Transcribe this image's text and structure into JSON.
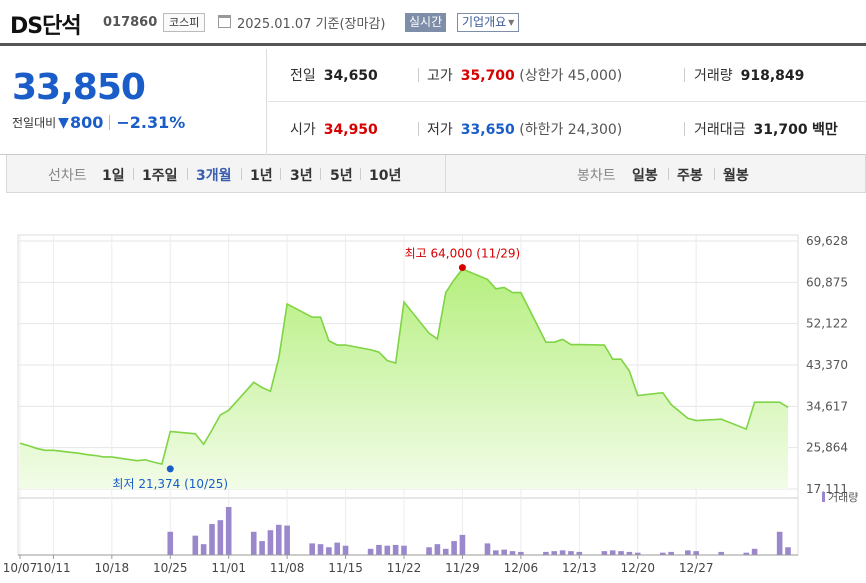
{
  "header": {
    "name": "DS단석",
    "code": "017860",
    "market": "코스피",
    "date": "2025.01.07 기준(장마감)",
    "realtime": "실시간",
    "company": "기업개요"
  },
  "summary": {
    "price": "33,850",
    "change_label": "전일대비",
    "change_value": "800",
    "change_rate": "−2.31%",
    "prev_label": "전일",
    "prev_value": "34,650",
    "high_label": "고가",
    "high_value": "35,700",
    "upper_limit": "(상한가 45,000)",
    "volume_label": "거래량",
    "volume_value": "918,849",
    "open_label": "시가",
    "open_value": "34,950",
    "low_label": "저가",
    "low_value": "33,650",
    "lower_limit": "(하한가 24,300)",
    "amount_label": "거래대금",
    "amount_value": "31,700",
    "amount_unit": "백만"
  },
  "tabs": {
    "line_label": "선차트",
    "line_tabs": [
      "1일",
      "1주일",
      "3개월",
      "1년",
      "3년",
      "5년",
      "10년"
    ],
    "candle_label": "봉차트",
    "candle_tabs": [
      "일봉",
      "주봉",
      "월봉"
    ]
  },
  "colors": {
    "price_down": "#1a5dc8",
    "price_up": "#d60000",
    "area_line": "#7fd444",
    "area_fill_top": "#b6ef7f",
    "volume_bar": "#9b88cc",
    "active_tab": "#3b5db0"
  },
  "chart_data": {
    "type": "area",
    "x": [
      "2024-10-07",
      "2024-10-08",
      "2024-10-09",
      "2024-10-10",
      "2024-10-11",
      "2024-10-14",
      "2024-10-15",
      "2024-10-16",
      "2024-10-17",
      "2024-10-18",
      "2024-10-21",
      "2024-10-22",
      "2024-10-23",
      "2024-10-24",
      "2024-10-25",
      "2024-10-28",
      "2024-10-29",
      "2024-10-30",
      "2024-10-31",
      "2024-11-01",
      "2024-11-04",
      "2024-11-05",
      "2024-11-06",
      "2024-11-07",
      "2024-11-08",
      "2024-11-11",
      "2024-11-12",
      "2024-11-13",
      "2024-11-14",
      "2024-11-15",
      "2024-11-18",
      "2024-11-19",
      "2024-11-20",
      "2024-11-21",
      "2024-11-22",
      "2024-11-25",
      "2024-11-26",
      "2024-11-27",
      "2024-11-28",
      "2024-11-29",
      "2024-12-02",
      "2024-12-03",
      "2024-12-04",
      "2024-12-05",
      "2024-12-06",
      "2024-12-09",
      "2024-12-10",
      "2024-12-11",
      "2024-12-12",
      "2024-12-13",
      "2024-12-16",
      "2024-12-17",
      "2024-12-18",
      "2024-12-19",
      "2024-12-20",
      "2024-12-23",
      "2024-12-24",
      "2024-12-26",
      "2024-12-27",
      "2024-12-30",
      "2025-01-02",
      "2025-01-03",
      "2025-01-06",
      "2025-01-07"
    ],
    "series": [
      {
        "values": [
          26800,
          26300,
          25700,
          25300,
          25300,
          24700,
          24400,
          24200,
          23900,
          23900,
          23100,
          23300,
          22800,
          22400,
          29300,
          28800,
          26600,
          29600,
          32800,
          33800,
          39700,
          38600,
          37800,
          44800,
          56300,
          53500,
          53500,
          48500,
          47600,
          47600,
          46600,
          46100,
          44300,
          43800,
          56700,
          50100,
          48900,
          58700,
          61400,
          63700,
          61500,
          59500,
          59800,
          58700,
          58700,
          48200,
          48200,
          48800,
          47700,
          47700,
          47600,
          44600,
          44600,
          42100,
          36900,
          37500,
          35000,
          32100,
          31600,
          31900,
          29800,
          35500,
          35500,
          34400
        ]
      }
    ],
    "volume": [
      0,
      0,
      0,
      0,
      0,
      0,
      0,
      0,
      0,
      0,
      0,
      0,
      0,
      0,
      30,
      25,
      14,
      40,
      45,
      62,
      30,
      18,
      32,
      39,
      38,
      15,
      14,
      10,
      16,
      12,
      8,
      13,
      12,
      13,
      12,
      10,
      14,
      8,
      18,
      26,
      15,
      6,
      7,
      5,
      4,
      4,
      5,
      6,
      5,
      4,
      5,
      6,
      5,
      4,
      3,
      3,
      4,
      6,
      5,
      4,
      3,
      8,
      30,
      10
    ],
    "y_ticks": [
      "69,628",
      "60,875",
      "52,122",
      "43,370",
      "34,617",
      "25,864",
      "17,111"
    ],
    "ylim": [
      17111,
      69628
    ],
    "x_ticks": [
      "10/07",
      "10/11",
      "10/18",
      "10/25",
      "11/01",
      "11/08",
      "11/15",
      "11/22",
      "11/29",
      "12/06",
      "12/13",
      "12/20",
      "12/27"
    ],
    "max_label": "최고 64,000 (11/29)",
    "max_value": 64000,
    "max_date": "2024-11-29",
    "min_label": "최저 21,374 (10/25)",
    "min_value": 21374,
    "min_date": "2024-10-25",
    "volume_legend": "거래량",
    "grid": true
  }
}
